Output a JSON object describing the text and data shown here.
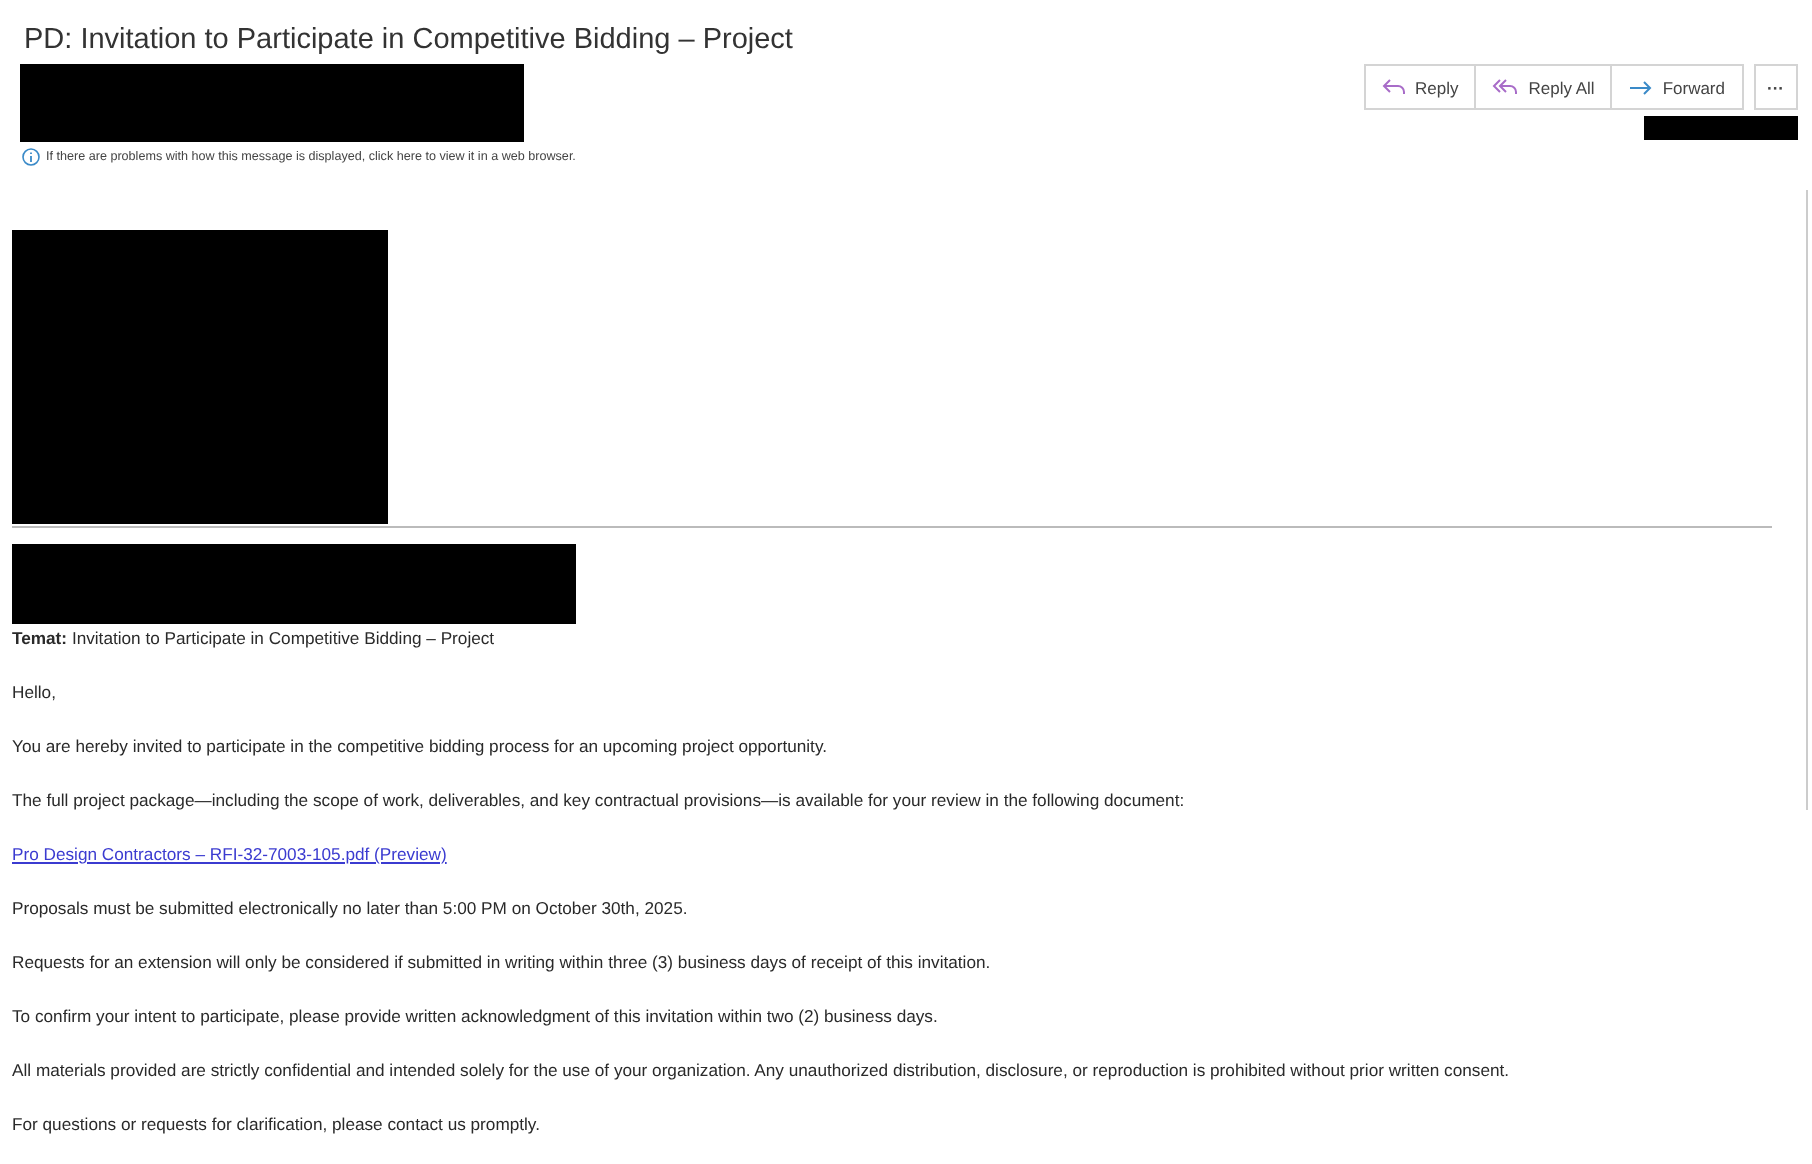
{
  "message": {
    "subject": "PD: Invitation to Participate in Competitive Bidding – Project",
    "sender": {
      "redacted": true
    },
    "info_bar": "If there are problems with how this message is displayed, click here to view it in a web browser.",
    "actions": [
      {
        "kind": "reply",
        "label": "Reply"
      },
      {
        "kind": "reply_all",
        "label": "Reply All"
      },
      {
        "kind": "forward",
        "label": "Forward"
      },
      {
        "kind": "more",
        "label": "···"
      }
    ],
    "recipient": {
      "redacted": true
    }
  },
  "body": {
    "banner": {
      "redacted": true
    },
    "quoted_header": {
      "redacted": true
    },
    "subject_line": {
      "label": "Temat:",
      "value": "Invitation to Participate in Competitive Bidding – Project"
    },
    "paragraphs": [
      {
        "kind": "text",
        "text": "Hello,"
      },
      {
        "kind": "text",
        "text": "You are hereby invited to participate in the competitive bidding process for an upcoming project opportunity."
      },
      {
        "kind": "text",
        "text": "The full project package—including the scope of work, deliverables, and key contractual provisions—is available for your review in the following document:"
      },
      {
        "kind": "link",
        "text": "Pro Design Contractors – RFI-32-7003-105.pdf (Preview)"
      },
      {
        "kind": "text",
        "text": "Proposals must be submitted electronically no later than 5:00 PM on October 30th, 2025."
      },
      {
        "kind": "text",
        "text": "Requests for an extension will only be considered if submitted in writing within three (3) business days of receipt of this invitation."
      },
      {
        "kind": "text",
        "text": "To confirm your intent to participate, please provide written acknowledgment of this invitation within two (2) business days."
      },
      {
        "kind": "text",
        "text": "All materials provided are strictly confidential and intended solely for the use of your organization. Any unauthorized distribution, disclosure, or reproduction is prohibited without prior written consent."
      },
      {
        "kind": "text",
        "text": "For questions or requests for clarification, please contact us promptly."
      }
    ]
  }
}
